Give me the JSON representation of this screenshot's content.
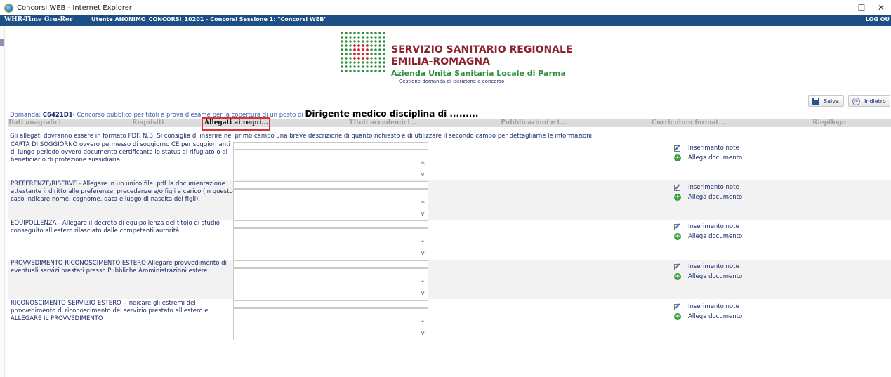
{
  "window": {
    "title": "Concorsi WEB - Internet Explorer",
    "minimize": "–",
    "maximize": "☐",
    "close": "✕"
  },
  "appbar": {
    "brand": "WHR-Time Gru-Rer",
    "user": "Utente ANONIMO_CONCORSI_10201 - Concorsi Sessione 1: \"Concorsi WEB\"",
    "logout": "LOG OU"
  },
  "logo": {
    "line1": "SERVIZIO SANITARIO REGIONALE",
    "line2": "EMILIA-ROMAGNA",
    "line3": "Azienda Unità Sanitaria Locale di Parma",
    "line4": "Gestione domanda di iscrizione a concorso"
  },
  "toolbar": {
    "save_label": "Salva",
    "back_label": "Indietro",
    "back_icon_glyph": "⊕"
  },
  "domanda": {
    "prefix": "Domanda: ",
    "code": "C6421D1",
    "description": "- Concorso pubblico per titoli e prova d'esame per la copertura di un posto di ",
    "position": "Dirigente medico disciplina di ........."
  },
  "tabs": [
    {
      "label": "Dati anagrafici",
      "active": false
    },
    {
      "label": "Requisiti",
      "active": false
    },
    {
      "label": "Allegati ai requi...",
      "active": true
    },
    {
      "label": "Titoli accademici...",
      "active": false
    },
    {
      "label": "Pubblicazioni e t...",
      "active": false
    },
    {
      "label": "Curriculum format...",
      "active": false
    },
    {
      "label": "Riepilogo",
      "active": false
    }
  ],
  "instructions": "Gli allegati dovranno essere in formato PDF. N.B. Si consiglia di inserire nel primo campo una breve descrizione di quanto richiesto e di utilizzare il secondo campo per dettagliarne le informazioni.",
  "attachments": [
    {
      "label": "CARTA DI SOGGIORNO ovvero permesso di soggiorno CE per soggiornanti di lungo periodo ovvero documento certificante lo status di rifugiato o di beneficiario di protezione sussidiaria",
      "short_value": "",
      "long_value": "",
      "note_label": "Inserimento note",
      "attach_label": "Allega documento"
    },
    {
      "label": "PREFERENZE/RISERVE - Allegare in un unico file .pdf la documentazione attestante il diritto alle preferenze, precedenze e/o figli a carico (in questo caso indicare nome, cognome, data e luogo di nascita dei figli).",
      "short_value": "",
      "long_value": "",
      "note_label": "Inserimento note",
      "attach_label": "Allega documento"
    },
    {
      "label": "EQUIPOLLENZA - Allegare il decreto di equipollenza del titolo di studio conseguito all'estero rilasciato dalle competenti autorità",
      "short_value": "",
      "long_value": "",
      "note_label": "Inserimento note",
      "attach_label": "Allega documento"
    },
    {
      "label": "PROVVEDIMENTO RICONOSCIMENTO ESTERO Allegare provvedimento di eventuali servizi prestati presso Pubbliche Amministrazioni estere",
      "short_value": "",
      "long_value": "",
      "note_label": "Inserimento note",
      "attach_label": "Allega documento"
    },
    {
      "label": "RICONOSCIMENTO SERVIZIO ESTERO - Indicare gli estremi del provvedimento di riconoscimento del servizio prestato all'estero e ALLEGARE IL PROVVEDIMENTO",
      "short_value": "",
      "long_value": "",
      "note_label": "Inserimento note",
      "attach_label": "Allega documento"
    }
  ],
  "scroll_glyphs": {
    "up": "^",
    "down": "v"
  }
}
